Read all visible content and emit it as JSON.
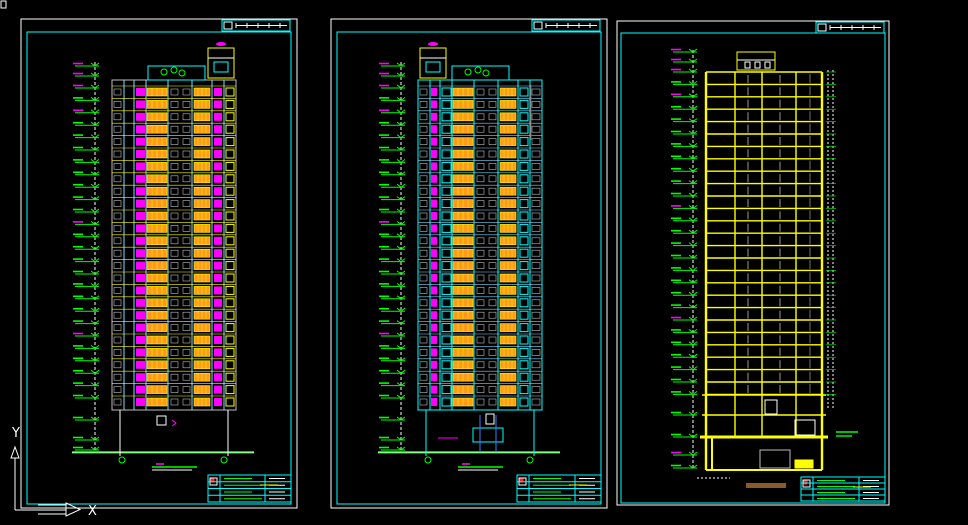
{
  "ucs": {
    "y_label": "Y",
    "x_label": "X"
  },
  "icons": {
    "ucs": "ucs-icon",
    "corner": "viewport-corner-icon"
  },
  "colors": {
    "background": "#000000",
    "frame": "#00ffff",
    "border": "#ffffff",
    "yellow": "#ffff00",
    "magenta": "#ff00ff",
    "green": "#00ff00",
    "window": "#ff9a1a",
    "grey": "#bdbdbd",
    "red": "#ff2020",
    "blue": "#3a7bff",
    "brown": "#8a5a2e"
  }
}
